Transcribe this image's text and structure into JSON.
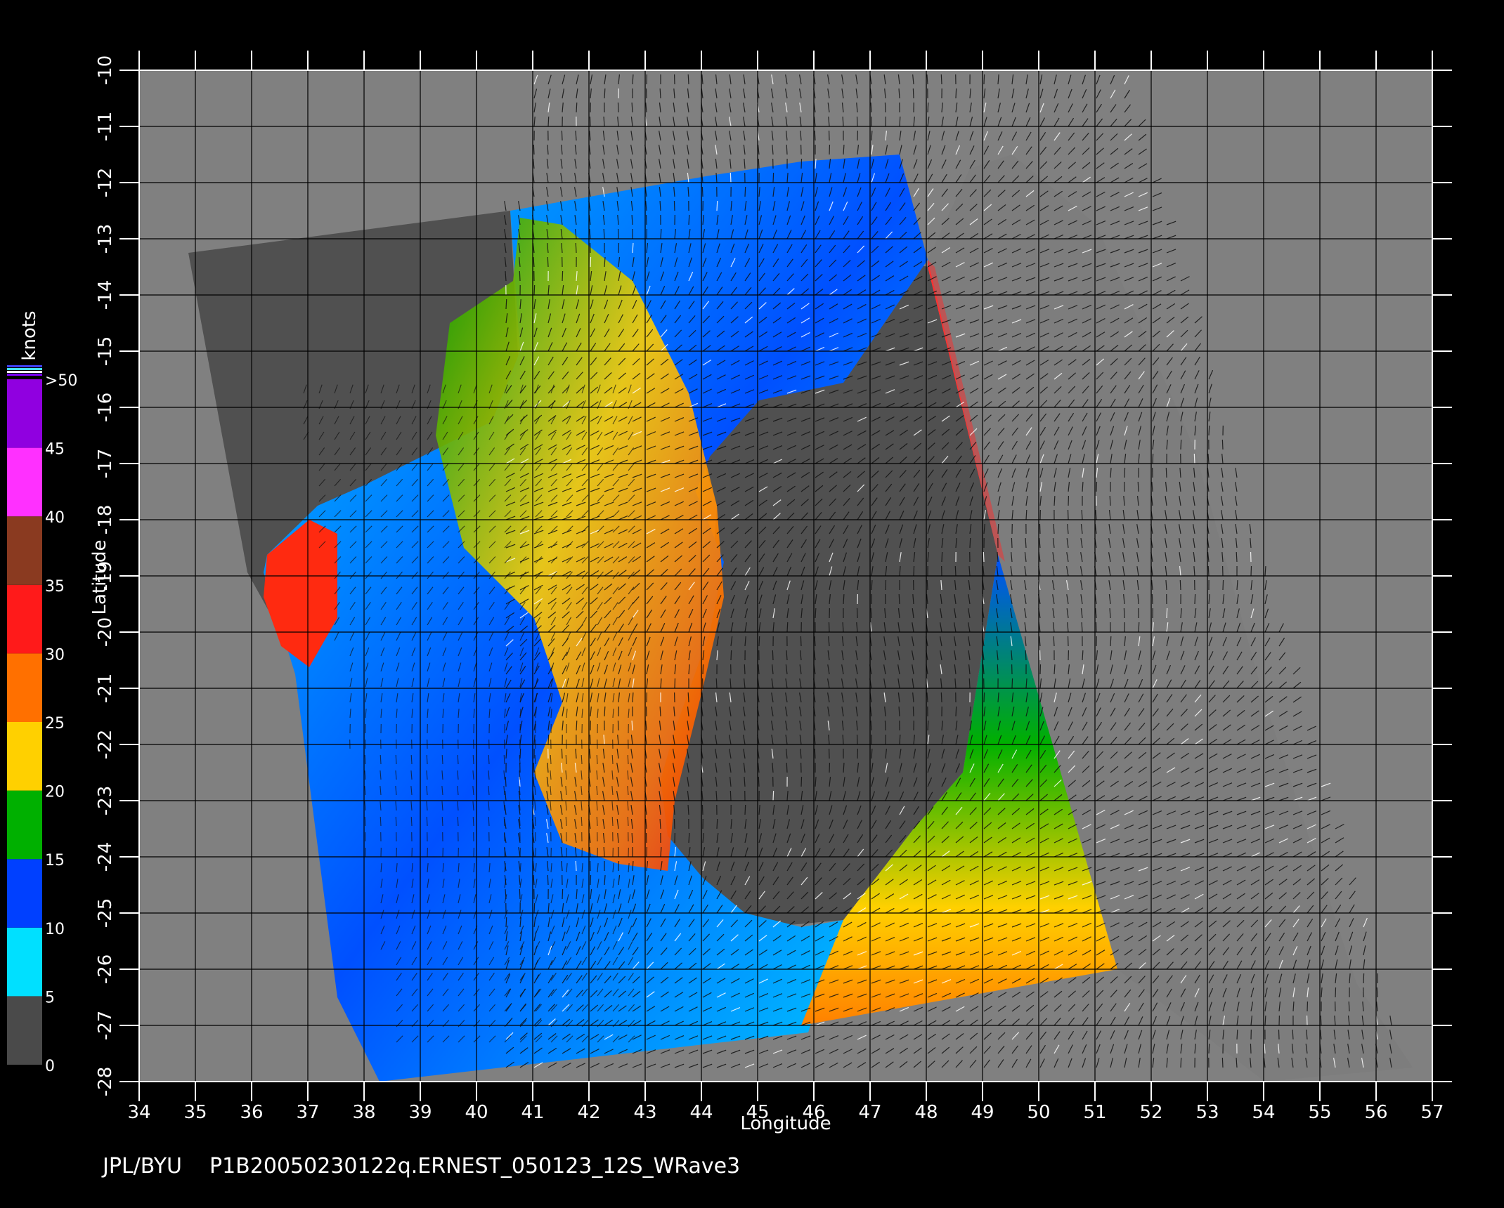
{
  "colors": {
    "background": "#000000",
    "outside_swath": "#808080",
    "land": "#505050",
    "grid": "#000000",
    "axis": "#ffffff",
    "wind_barb": "#111111"
  },
  "map": {
    "lon_range": [
      34,
      57
    ],
    "lat_range": [
      -28,
      -10
    ],
    "lon_ticks": [
      "34",
      "35",
      "36",
      "37",
      "38",
      "39",
      "40",
      "41",
      "42",
      "43",
      "44",
      "45",
      "46",
      "47",
      "48",
      "49",
      "50",
      "51",
      "52",
      "53",
      "54",
      "55",
      "56",
      "57"
    ],
    "lat_ticks": [
      "-10",
      "-11",
      "-12",
      "-13",
      "-14",
      "-15",
      "-16",
      "-17",
      "-18",
      "-19",
      "-20",
      "-21",
      "-22",
      "-23",
      "-24",
      "-25",
      "-26",
      "-27",
      "-28"
    ],
    "xlabel": "Longitude",
    "ylabel": "Latitude",
    "grid": true
  },
  "colorbar": {
    "unit": "knots",
    "labels": [
      ">50",
      "45",
      "40",
      "35",
      "30",
      "25",
      "20",
      "15",
      "10",
      "5",
      "0"
    ],
    "bands": [
      {
        "from": 0,
        "to": 5,
        "color": "#4a4a4a"
      },
      {
        "from": 5,
        "to": 10,
        "color": "#00e0ff"
      },
      {
        "from": 10,
        "to": 15,
        "color": "#0040ff"
      },
      {
        "from": 15,
        "to": 20,
        "color": "#00b000"
      },
      {
        "from": 20,
        "to": 25,
        "color": "#ffd000"
      },
      {
        "from": 25,
        "to": 30,
        "color": "#ff7000"
      },
      {
        "from": 30,
        "to": 35,
        "color": "#ff1a1a"
      },
      {
        "from": 35,
        "to": 40,
        "color": "#8a3a20"
      },
      {
        "from": 40,
        "to": 45,
        "color": "#ff30ff"
      },
      {
        "from": 45,
        "to": 50,
        "color": "#9000e0"
      }
    ]
  },
  "footer": {
    "source": "JPL/BYU",
    "filename": "P1B20050230122q.ERNEST_050123_12S_WRave3"
  }
}
